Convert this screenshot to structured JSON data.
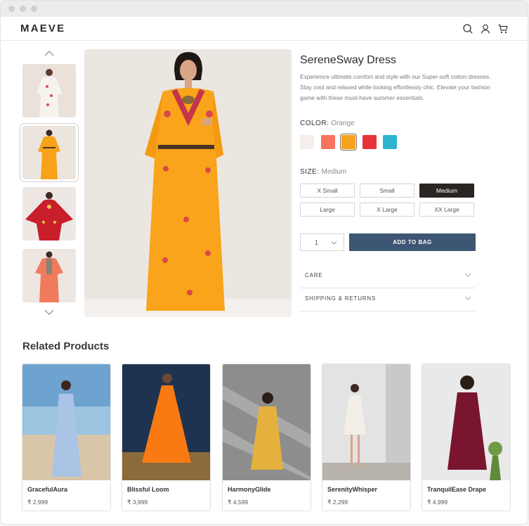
{
  "brand": "MAEVE",
  "icons": [
    "search-icon",
    "user-icon",
    "cart-icon",
    "chevron-up-icon",
    "chevron-down-icon"
  ],
  "product": {
    "title": "SereneSway Dress",
    "description": "Experience ultimate comfort and style with our Super-soft cotton dresses. Stay cool and relaxed while looking effortlessly chic. Elevate your fashion game with these must-have summer essentials.",
    "color_label": "COLOR:",
    "color_value": "Orange",
    "colors": [
      "#f5eeec",
      "#f7735c",
      "#f7a11d",
      "#e8323a",
      "#2fb4d0"
    ],
    "selected_color_index": 2,
    "size_label": "SIZE:",
    "size_value": "Medium",
    "sizes": [
      "X Small",
      "Small",
      "Medium",
      "Large",
      "X Large",
      "XX Large"
    ],
    "selected_size_index": 2,
    "quantity": "1",
    "add_to_bag": "ADD TO BAG",
    "accordions": [
      "CARE",
      "SHIPPING & RETURNS"
    ]
  },
  "related": {
    "title": "Related Products",
    "items": [
      {
        "name": "GracefulAura",
        "price": "₹ 2,999"
      },
      {
        "name": "Blissful Loom",
        "price": "₹ 3,999"
      },
      {
        "name": "HarmonyGlide",
        "price": "₹ 4,599"
      },
      {
        "name": "SerenityWhisper",
        "price": "₹ 2,299"
      },
      {
        "name": "TranquilEase Drape",
        "price": "₹ 4,999"
      }
    ]
  }
}
